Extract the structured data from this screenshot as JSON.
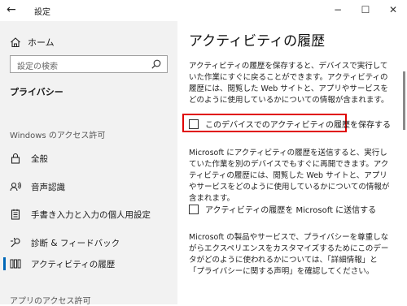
{
  "window": {
    "title": "設定",
    "back_glyph": "←",
    "minimize_glyph": "−",
    "maximize_glyph": "☐",
    "close_glyph": "✕"
  },
  "sidebar": {
    "home_label": "ホーム",
    "search_placeholder": "設定の検索",
    "current_section": "プライバシー",
    "group_windows": "Windows のアクセス許可",
    "items": [
      {
        "label": "全般",
        "icon": "lock-icon"
      },
      {
        "label": "音声認識",
        "icon": "speech-icon"
      },
      {
        "label": "手書き入力と入力の個人用設定",
        "icon": "notepad-icon"
      },
      {
        "label": "診断 & フィードバック",
        "icon": "diagnostics-icon"
      },
      {
        "label": "アクティビティの履歴",
        "icon": "activity-history-icon"
      }
    ],
    "group_apps": "アプリのアクセス許可"
  },
  "main": {
    "heading": "アクティビティの履歴",
    "intro": "アクティビティの履歴を保存すると、デバイスで実行していた作業にすぐに戻ることができます。アクティビティの履歴には、閲覧した Web サイトと、アプリやサービスをどのように使用しているかについての情報が含まれます。",
    "checkbox_local": "このデバイスでのアクティビティの履歴を保存する",
    "send_desc": "Microsoft にアクティビティの履歴を送信すると、実行していた作業を別のデバイスでもすぐに再開できます。アクティビティの履歴には、閲覧した Web サイトと、アプリやサービスをどのように使用しているかについての情報が含まれます。",
    "checkbox_send": "アクティビティの履歴を Microsoft に送信する",
    "footer": "Microsoft の製品やサービスで、プライバシーを尊重しながらエクスペリエンスをカスタマイズするためにこのデータがどのように使われるかについては、「詳細情報」と「プライバシーに関する声明」を確認してください。"
  },
  "colors": {
    "sidebar_bg": "#f2f2f2",
    "accent": "#0067b8",
    "highlight": "#e00000"
  }
}
